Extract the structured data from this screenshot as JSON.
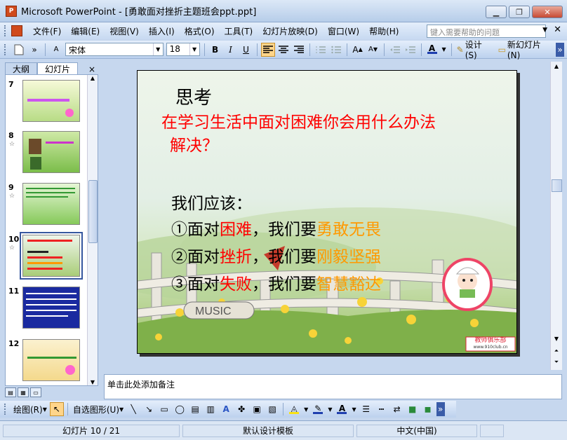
{
  "window": {
    "title": "Microsoft PowerPoint - [勇敢面对挫折主题班会ppt.ppt]"
  },
  "menu": {
    "items": [
      "文件(F)",
      "编辑(E)",
      "视图(V)",
      "插入(I)",
      "格式(O)",
      "工具(T)",
      "幻灯片放映(D)",
      "窗口(W)",
      "帮助(H)"
    ],
    "help_placeholder": "键入需要帮助的问题"
  },
  "toolbar": {
    "font_name": "宋体",
    "font_size": "18",
    "bold": "B",
    "italic": "I",
    "underline": "U",
    "design_label": "设计(S)",
    "new_slide_label": "新幻灯片(N)"
  },
  "panel": {
    "tab_outline": "大纲",
    "tab_slides": "幻灯片",
    "close": "×",
    "thumbs": [
      {
        "num": "7"
      },
      {
        "num": "8"
      },
      {
        "num": "9"
      },
      {
        "num": "10"
      },
      {
        "num": "11"
      },
      {
        "num": "12"
      }
    ]
  },
  "slide": {
    "title": "思考",
    "question_line1": "在学习生活中面对困难你会用什么办法",
    "question_line2": "解决？",
    "intro": "我们应该：",
    "items": [
      {
        "prefix": "①面对",
        "obstacle": "困难",
        "middle": "，我们要",
        "virtue": "勇敢无畏"
      },
      {
        "prefix": "②面对",
        "obstacle": "挫折",
        "middle": "，我们要",
        "virtue": "刚毅坚强"
      },
      {
        "prefix": "③面对",
        "obstacle": "失败",
        "middle": "，我们要",
        "virtue": "智慧豁达"
      }
    ],
    "badge": "教师俱乐部",
    "badge_url": "www.910club.cn",
    "sign_text": "MUSIC",
    "colors": {
      "question": "#ff0000",
      "obstacle": "#ff0000",
      "virtue": "#ff9900"
    }
  },
  "notes": {
    "placeholder": "单击此处添加备注"
  },
  "drawbar": {
    "draw_label": "绘图(R)",
    "autoshape_label": "自选图形(U)"
  },
  "status": {
    "slide_pos": "幻灯片 10 / 21",
    "template": "默认设计模板",
    "language": "中文(中国)"
  }
}
